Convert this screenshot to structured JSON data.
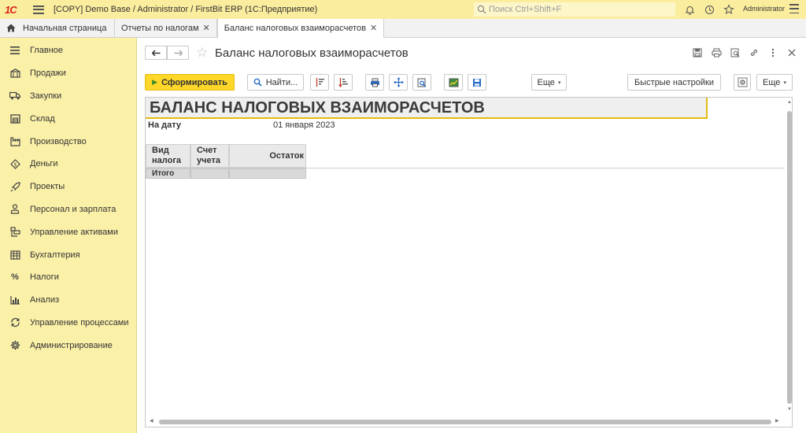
{
  "app": {
    "logo": "1С",
    "title": "[COPY] Demo Base / Administrator / FirstBit ERP  (1С:Предприятие)",
    "search_placeholder": "Поиск Ctrl+Shift+F",
    "user": "Administrator"
  },
  "tabs": [
    {
      "label": "Начальная страница"
    },
    {
      "label": "Отчеты по налогам"
    },
    {
      "label": "Баланс налоговых взаиморасчетов"
    }
  ],
  "sidebar": {
    "items": [
      {
        "label": "Главное",
        "icon": "menu-icon"
      },
      {
        "label": "Продажи",
        "icon": "sales-icon"
      },
      {
        "label": "Закупки",
        "icon": "truck-icon"
      },
      {
        "label": "Склад",
        "icon": "warehouse-icon"
      },
      {
        "label": "Производство",
        "icon": "factory-icon"
      },
      {
        "label": "Деньги",
        "icon": "money-icon"
      },
      {
        "label": "Проекты",
        "icon": "rocket-icon"
      },
      {
        "label": "Персонал и зарплата",
        "icon": "person-icon"
      },
      {
        "label": "Управление активами",
        "icon": "assets-icon"
      },
      {
        "label": "Бухгалтерия",
        "icon": "ledger-icon"
      },
      {
        "label": "Налоги",
        "icon": "percent-icon"
      },
      {
        "label": "Анализ",
        "icon": "chart-icon"
      },
      {
        "label": "Управление процессами",
        "icon": "cycle-icon"
      },
      {
        "label": "Администрирование",
        "icon": "gear-icon"
      }
    ]
  },
  "form": {
    "title": "Баланс налоговых взаиморасчетов"
  },
  "toolbar": {
    "generate_label": "Сформировать",
    "find_label": "Найти...",
    "more_label": "Еще",
    "quick_settings_label": "Быстрые настройки",
    "more2_label": "Еще"
  },
  "report": {
    "title": "БАЛАНС НАЛОГОВЫХ ВЗАИМОРАСЧЕТОВ",
    "param_label": "На дату",
    "param_value": "01 января 2023",
    "columns": [
      {
        "line1": "Вид",
        "line2": "налога"
      },
      {
        "line1": "Счет",
        "line2": "учета"
      },
      {
        "line1": "Остаток",
        "line2": ""
      }
    ],
    "total_label": "Итого"
  }
}
